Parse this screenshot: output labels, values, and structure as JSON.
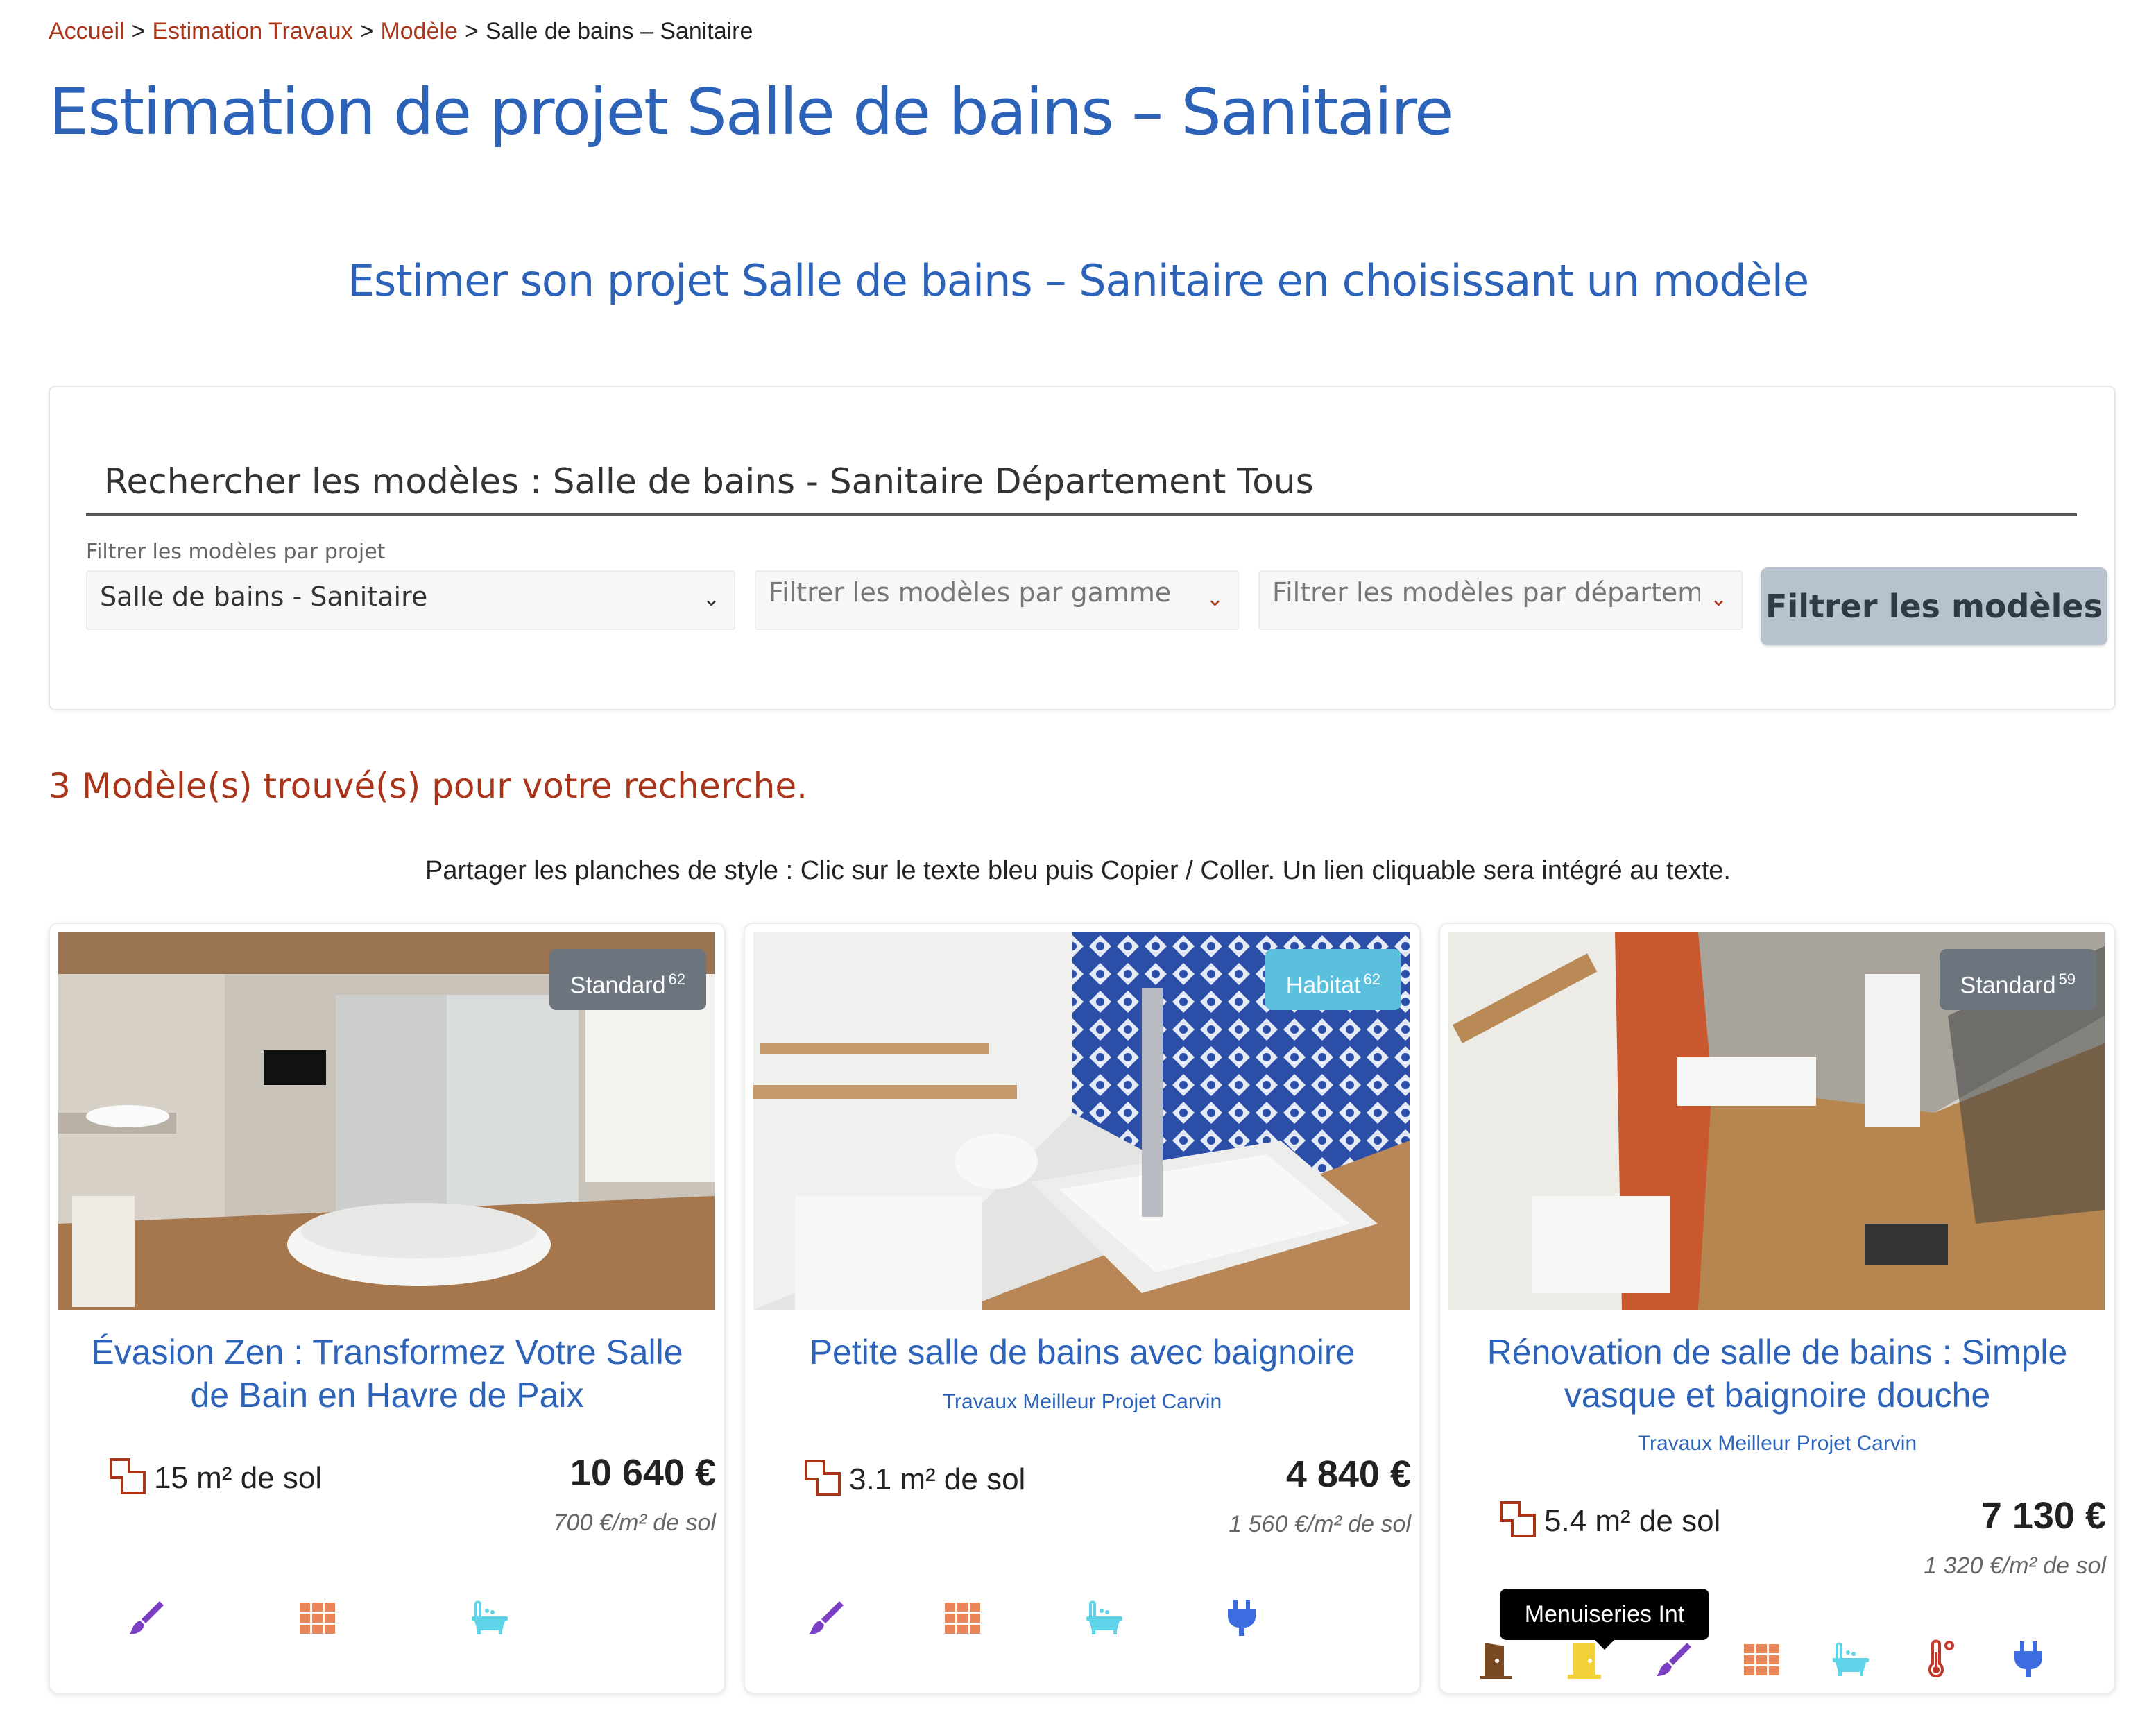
{
  "breadcrumb": {
    "items": [
      "Accueil",
      "Estimation Travaux",
      "Modèle"
    ],
    "current": "Salle de bains – Sanitaire",
    "separator": ">"
  },
  "page_title": "Estimation de projet Salle de bains – Sanitaire",
  "subtitle": "Estimer son projet Salle de bains – Sanitaire en choisissant un modèle",
  "search": {
    "value": "Rechercher les modèles : Salle de bains - Sanitaire Département Tous",
    "project_filter_label": "Filtrer les modèles par projet",
    "project_filter_value": "Salle de bains - Sanitaire",
    "range_filter_placeholder": "Filtrer les modèles par gamme",
    "department_filter_placeholder": "Filtrer les modèles par département",
    "button_label": "Filtrer les modèles"
  },
  "results": {
    "count_text": "3 Modèle(s) trouvé(s) pour votre recherche.",
    "share_note": "Partager les planches de style : Clic sur le texte bleu puis Copier / Coller. Un lien cliquable sera intégré au texte."
  },
  "cards": [
    {
      "badge": "Standard",
      "badge_count": "62",
      "title": "Évasion Zen : Transformez Votre Salle de Bain en Havre de Paix",
      "author": "",
      "area": "15 m² de sol",
      "price": "10 640 €",
      "price_per_m2": "700 €/m² de sol",
      "icons": [
        "paint-brush-icon",
        "tiles-icon",
        "bathtub-icon"
      ]
    },
    {
      "badge": "Habitat",
      "badge_count": "62",
      "title": "Petite salle de bains avec baignoire",
      "author": "Travaux Meilleur Projet Carvin",
      "area": "3.1 m² de sol",
      "price": "4 840 €",
      "price_per_m2": "1 560 €/m² de sol",
      "icons": [
        "paint-brush-icon",
        "tiles-icon",
        "bathtub-icon",
        "electric-plug-icon"
      ]
    },
    {
      "badge": "Standard",
      "badge_count": "59",
      "title": "Rénovation de salle de bains : Simple vasque et baignoire douche",
      "author": "Travaux Meilleur Projet Carvin",
      "area": "5.4 m² de sol",
      "price": "7 130 €",
      "price_per_m2": "1 320 €/m² de sol",
      "icons": [
        "interior-door-icon",
        "exterior-door-icon",
        "paint-brush-icon",
        "tiles-icon",
        "bathtub-icon",
        "thermometer-icon",
        "electric-plug-icon"
      ]
    }
  ],
  "tooltip": "Menuiseries Int",
  "colors": {
    "title_blue": "#2c63b8",
    "link_red": "#a93418",
    "badge_grey": "#6c757d",
    "badge_blue": "#5bc0de",
    "button_grey": "#b7c2ce"
  }
}
